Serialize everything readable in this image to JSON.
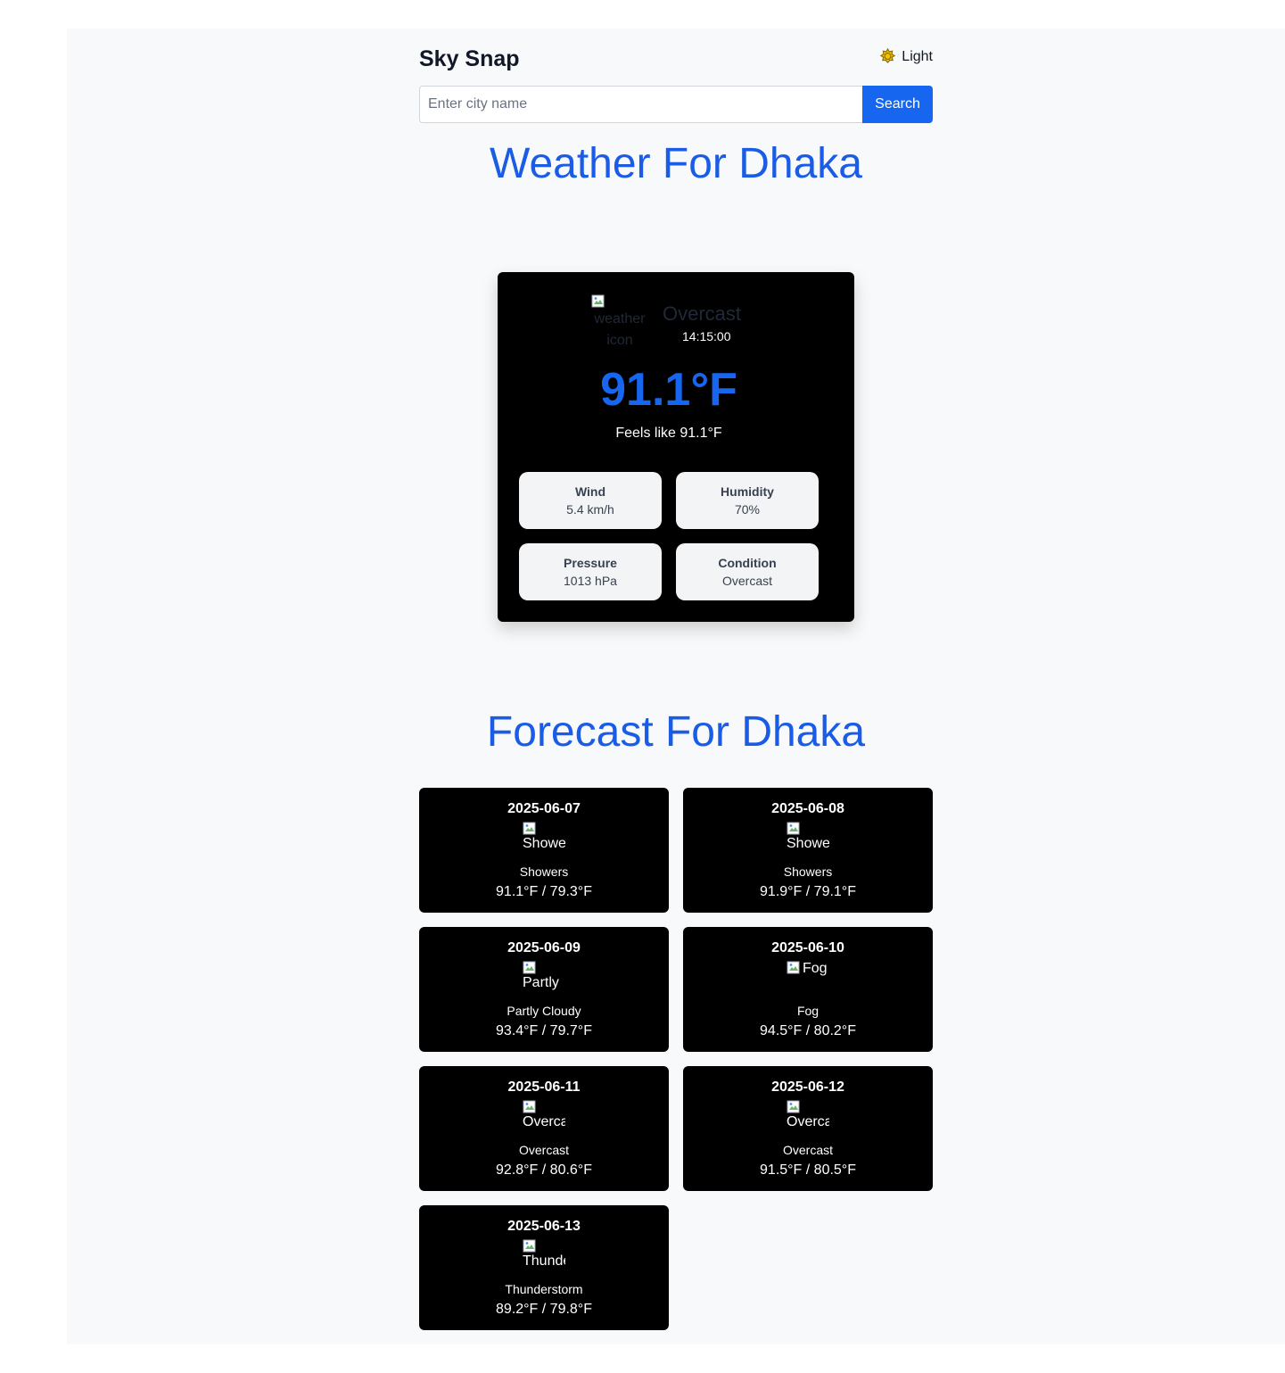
{
  "header": {
    "brand": "Sky Snap",
    "theme_label": "Light",
    "theme_icon": "sun-icon"
  },
  "search": {
    "placeholder": "Enter city name",
    "value": "",
    "button_label": "Search"
  },
  "current": {
    "title": "Weather For Dhaka",
    "icon_alt": "weather icon",
    "condition": "Overcast",
    "time": "14:15:00",
    "temperature": "91.1°F",
    "feels_like": "Feels like 91.1°F",
    "stats": {
      "wind": {
        "label": "Wind",
        "value": "5.4 km/h"
      },
      "humidity": {
        "label": "Humidity",
        "value": "70%"
      },
      "pressure": {
        "label": "Pressure",
        "value": "1013 hPa"
      },
      "condition": {
        "label": "Condition",
        "value": "Overcast"
      }
    }
  },
  "forecast": {
    "title": "Forecast For Dhaka",
    "days": [
      {
        "date": "2025-06-07",
        "icon_alt": "Showe",
        "condition": "Showers",
        "temps": "91.1°F / 79.3°F"
      },
      {
        "date": "2025-06-08",
        "icon_alt": "Showe",
        "condition": "Showers",
        "temps": "91.9°F / 79.1°F"
      },
      {
        "date": "2025-06-09",
        "icon_alt": "Partly",
        "condition": "Partly Cloudy",
        "temps": "93.4°F / 79.7°F"
      },
      {
        "date": "2025-06-10",
        "icon_alt": "Fog",
        "condition": "Fog",
        "temps": "94.5°F / 80.2°F"
      },
      {
        "date": "2025-06-11",
        "icon_alt": "Overca",
        "condition": "Overcast",
        "temps": "92.8°F / 80.6°F"
      },
      {
        "date": "2025-06-12",
        "icon_alt": "Overca",
        "condition": "Overcast",
        "temps": "91.5°F / 80.5°F"
      },
      {
        "date": "2025-06-13",
        "icon_alt": "Thunde",
        "condition": "Thunderstorm",
        "temps": "89.2°F / 79.8°F"
      }
    ]
  },
  "colors": {
    "accent": "#1766f0",
    "title": "#1a5ce6",
    "card_bg": "#000000",
    "page_bg": "#f8f9fb",
    "sun": "#f5c400"
  }
}
